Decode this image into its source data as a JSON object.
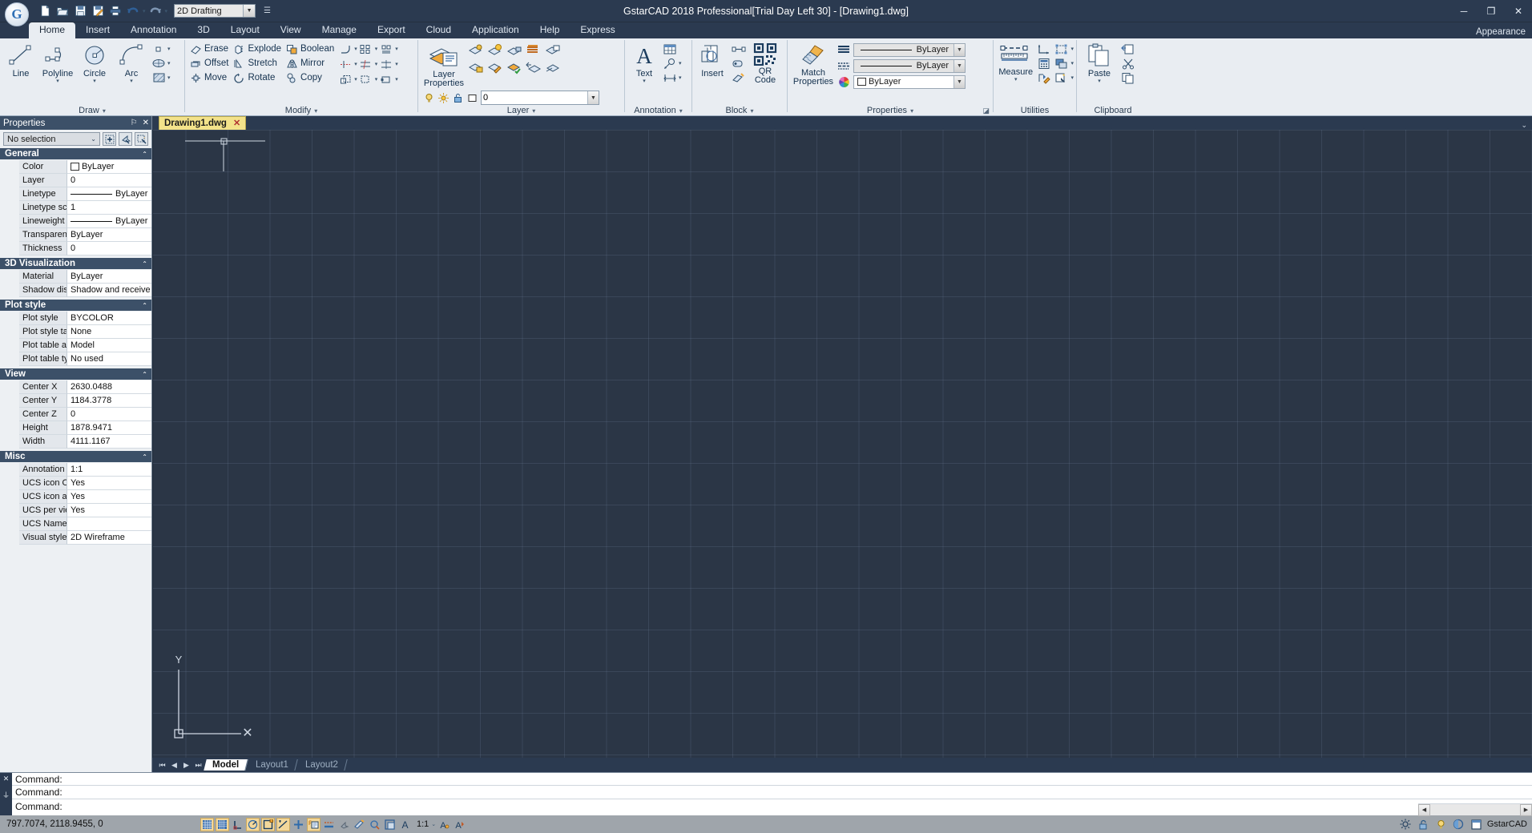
{
  "titlebar": {
    "title": "GstarCAD 2018 Professional[Trial Day Left 30] - [Drawing1.dwg]",
    "logo_letter": "G",
    "workspace_value": "2D Drafting",
    "quick_access": [
      {
        "name": "new-file-icon",
        "label": "New"
      },
      {
        "name": "open-file-icon",
        "label": "Open"
      },
      {
        "name": "save-icon",
        "label": "Save"
      },
      {
        "name": "save-as-icon",
        "label": "Save As"
      },
      {
        "name": "print-icon",
        "label": "Plot"
      },
      {
        "name": "undo-icon",
        "label": "Undo"
      },
      {
        "name": "redo-icon",
        "label": "Redo"
      }
    ],
    "window_buttons": {
      "minimize": "─",
      "maximize": "❐",
      "close": "✕"
    }
  },
  "ribbon_tabs": {
    "items": [
      {
        "label": "Home",
        "active": true
      },
      {
        "label": "Insert",
        "active": false
      },
      {
        "label": "Annotation",
        "active": false
      },
      {
        "label": "3D",
        "active": false
      },
      {
        "label": "Layout",
        "active": false
      },
      {
        "label": "View",
        "active": false
      },
      {
        "label": "Manage",
        "active": false
      },
      {
        "label": "Export",
        "active": false
      },
      {
        "label": "Cloud",
        "active": false
      },
      {
        "label": "Application",
        "active": false
      },
      {
        "label": "Help",
        "active": false
      },
      {
        "label": "Express",
        "active": false
      }
    ],
    "appearance": "Appearance"
  },
  "ribbon": {
    "draw": {
      "title": "Draw",
      "big_buttons": [
        {
          "label": "Line",
          "icon": "line-icon",
          "dropdown": false
        },
        {
          "label": "Polyline",
          "icon": "polyline-icon",
          "dropdown": true
        },
        {
          "label": "Circle",
          "icon": "circle-icon",
          "dropdown": true
        },
        {
          "label": "Arc",
          "icon": "arc-icon",
          "dropdown": true
        }
      ],
      "small_icons": [
        {
          "name": "rectangle-icon",
          "dropdown": true
        },
        {
          "name": "ellipse-icon",
          "dropdown": true
        },
        {
          "name": "hatch-icon",
          "dropdown": true
        }
      ]
    },
    "modify": {
      "title": "Modify",
      "commands": [
        {
          "label": "Erase",
          "icon": "erase-icon"
        },
        {
          "label": "Explode",
          "icon": "explode-icon"
        },
        {
          "label": "Boolean",
          "icon": "boolean-icon"
        },
        {
          "label": "Offset",
          "icon": "offset-icon"
        },
        {
          "label": "Stretch",
          "icon": "stretch-icon"
        },
        {
          "label": "Mirror",
          "icon": "mirror-icon"
        },
        {
          "label": "Move",
          "icon": "move-icon"
        },
        {
          "label": "Rotate",
          "icon": "rotate-icon"
        },
        {
          "label": "Copy",
          "icon": "copy-icon"
        }
      ],
      "extra_icons": [
        {
          "name": "fillet-icon",
          "dropdown": true
        },
        {
          "name": "array-icon",
          "dropdown": true
        },
        {
          "name": "trim-icon",
          "dropdown": true
        },
        {
          "name": "scale-icon",
          "dropdown": true
        },
        {
          "name": "break-icon",
          "dropdown": true
        },
        {
          "name": "align-icon",
          "dropdown": true
        },
        {
          "name": "edit-polyline-icon",
          "dropdown": true
        },
        {
          "name": "divide-icon",
          "dropdown": true
        },
        {
          "name": "stretch-multi-icon",
          "dropdown": true
        }
      ]
    },
    "layer": {
      "title": "Layer",
      "main_button": {
        "label": "Layer\nProperties",
        "line1": "Layer",
        "line2": "Properties",
        "icon": "layer-properties-icon"
      },
      "tool_icons": [
        {
          "name": "layer-isolate-icon"
        },
        {
          "name": "layer-on-icon"
        },
        {
          "name": "layer-unlock-icon"
        },
        {
          "name": "layer-freeze-icon"
        },
        {
          "name": "layer-off-icon"
        },
        {
          "name": "layer-previous-icon"
        },
        {
          "name": "layer-match-icon"
        },
        {
          "name": "layer-merge-icon"
        },
        {
          "name": "layer-lock-icon"
        },
        {
          "name": "layer-change-icon"
        },
        {
          "name": "layer-current-icon"
        },
        {
          "name": "layer-walk-icon"
        },
        {
          "name": "layer-delete-icon"
        }
      ],
      "layer_combo": {
        "value": "0",
        "status_icons": [
          "bulb-icon",
          "sun-icon",
          "lock-icon",
          "color-swatch-icon"
        ]
      }
    },
    "annotation": {
      "title": "Annotation",
      "main_button": {
        "label": "Text",
        "icon": "text-icon",
        "dropdown": true
      },
      "tool_icons": [
        {
          "name": "table-icon",
          "dropdown": false
        },
        {
          "name": "leader-icon",
          "dropdown": true
        },
        {
          "name": "dimension-icon",
          "dropdown": true
        }
      ]
    },
    "block": {
      "title": "Block",
      "main_button": {
        "label": "Insert",
        "icon": "insert-block-icon"
      },
      "tools": [
        {
          "name": "create-block-icon"
        },
        {
          "name": "edit-block-icon"
        },
        {
          "name": "define-attribute-icon"
        }
      ],
      "qr": {
        "label_line1": "QR",
        "label_line2": "Code",
        "icon": "qr-code-icon",
        "dropdown": true
      }
    },
    "properties": {
      "title": "Properties",
      "match_button": {
        "line1": "Match",
        "line2": "Properties",
        "icon": "match-properties-icon"
      },
      "rows": [
        {
          "icon": "lineweight-icon",
          "value": "ByLayer",
          "type": "lineweight"
        },
        {
          "icon": "linetype-icon",
          "value": "ByLayer",
          "type": "linetype"
        },
        {
          "icon": "color-wheel-icon",
          "value": "ByLayer",
          "type": "color"
        }
      ],
      "dialog_launcher": "properties-dialog-launcher"
    },
    "utilities": {
      "title": "Utilities",
      "main_button": {
        "label": "Measure",
        "icon": "measure-icon",
        "dropdown": true
      },
      "tools": [
        {
          "name": "ucs-icon"
        },
        {
          "name": "quick-select-icon",
          "dropdown": true
        },
        {
          "name": "calculator-icon"
        },
        {
          "name": "draworder-icon",
          "dropdown": true
        },
        {
          "name": "point-style-icon"
        },
        {
          "name": "isolate-objects-icon",
          "dropdown": true
        }
      ]
    },
    "clipboard": {
      "title": "Clipboard",
      "main_button": {
        "label": "Paste",
        "icon": "paste-icon",
        "dropdown": true
      },
      "tools": [
        {
          "name": "copy-clip-icon"
        },
        {
          "name": "cut-icon"
        },
        {
          "name": "copy-icon"
        }
      ]
    }
  },
  "properties_palette": {
    "header": "Properties",
    "header_buttons": [
      {
        "name": "auto-hide-icon",
        "glyph": "⚐"
      },
      {
        "name": "close-icon",
        "glyph": "✕"
      }
    ],
    "selection": "No selection",
    "toolbar_buttons": [
      {
        "name": "toggle-pickadd-icon",
        "glyph": "⬚"
      },
      {
        "name": "select-objects-icon",
        "glyph": "↖"
      },
      {
        "name": "quick-select-icon",
        "glyph": "⚒"
      }
    ],
    "groups": [
      {
        "title": "General",
        "rows": [
          {
            "key": "Color",
            "value": "ByLayer",
            "kind": "color"
          },
          {
            "key": "Layer",
            "value": "0",
            "kind": "text"
          },
          {
            "key": "Linetype",
            "value": "ByLayer",
            "kind": "linetype"
          },
          {
            "key": "Linetype scale",
            "value": "1",
            "kind": "text"
          },
          {
            "key": "Lineweight",
            "value": "ByLayer",
            "kind": "linetype"
          },
          {
            "key": "Transparency",
            "value": "ByLayer",
            "kind": "text"
          },
          {
            "key": "Thickness",
            "value": "0",
            "kind": "text"
          }
        ]
      },
      {
        "title": "3D Visualization",
        "rows": [
          {
            "key": "Material",
            "value": "ByLayer",
            "kind": "text"
          },
          {
            "key": "Shadow disp...",
            "value": "Shadow and receive ...",
            "kind": "text"
          }
        ]
      },
      {
        "title": "Plot style",
        "rows": [
          {
            "key": "Plot style",
            "value": "BYCOLOR",
            "kind": "text"
          },
          {
            "key": "Plot style table",
            "value": "None",
            "kind": "text"
          },
          {
            "key": "Plot table att...",
            "value": "Model",
            "kind": "text"
          },
          {
            "key": "Plot table type",
            "value": "No used",
            "kind": "text"
          }
        ]
      },
      {
        "title": "View",
        "rows": [
          {
            "key": "Center X",
            "value": "2630.0488",
            "kind": "text"
          },
          {
            "key": "Center Y",
            "value": "1184.3778",
            "kind": "text"
          },
          {
            "key": "Center Z",
            "value": "0",
            "kind": "text"
          },
          {
            "key": "Height",
            "value": "1878.9471",
            "kind": "text"
          },
          {
            "key": "Width",
            "value": "4111.1167",
            "kind": "text"
          }
        ]
      },
      {
        "title": "Misc",
        "rows": [
          {
            "key": "Annotation s...",
            "value": "1:1",
            "kind": "text"
          },
          {
            "key": "UCS icon On",
            "value": "Yes",
            "kind": "text"
          },
          {
            "key": "UCS icon at ...",
            "value": "Yes",
            "kind": "text"
          },
          {
            "key": "UCS per vie...",
            "value": "Yes",
            "kind": "text"
          },
          {
            "key": "UCS Name",
            "value": "",
            "kind": "text"
          },
          {
            "key": "Visual styles",
            "value": "2D Wireframe",
            "kind": "text"
          }
        ]
      }
    ]
  },
  "document": {
    "tab_label": "Drawing1.dwg",
    "tab_close": "✕",
    "overflow_glyph": "⌄"
  },
  "canvas": {
    "ucs_x_label": "X",
    "ucs_y_label": "Y",
    "background": "#2b3646"
  },
  "layout_bar": {
    "nav": [
      {
        "name": "first-layout-button",
        "glyph": "⏮"
      },
      {
        "name": "prev-layout-button",
        "glyph": "◀"
      },
      {
        "name": "next-layout-button",
        "glyph": "▶"
      },
      {
        "name": "last-layout-button",
        "glyph": "⏭"
      }
    ],
    "tabs": [
      {
        "label": "Model",
        "active": true
      },
      {
        "label": "Layout1",
        "active": false
      },
      {
        "label": "Layout2",
        "active": false
      }
    ]
  },
  "command_line": {
    "gutter": [
      {
        "name": "close-command-icon",
        "glyph": "✕"
      },
      {
        "name": "pin-command-icon",
        "glyph": "⏚"
      }
    ],
    "lines": [
      "Command:",
      "Command:",
      "Command:"
    ],
    "scroll_left": "◀",
    "scroll_right": "▶"
  },
  "statusbar": {
    "coordinates": "797.7074, 2118.9455, 0",
    "toggles": [
      {
        "name": "snap-mode-toggle",
        "label": "SNAP",
        "on": true
      },
      {
        "name": "grid-display-toggle",
        "label": "GRID",
        "on": true
      },
      {
        "name": "ortho-mode-toggle",
        "label": "ORTHO",
        "on": false
      },
      {
        "name": "polar-tracking-toggle",
        "label": "POLAR",
        "on": true
      },
      {
        "name": "object-snap-toggle",
        "label": "OSNAP",
        "on": true
      },
      {
        "name": "object-snap-tracking-toggle",
        "label": "OTRACK",
        "on": true
      },
      {
        "name": "dynamic-ucs-toggle",
        "label": "DUCS",
        "on": false
      },
      {
        "name": "dynamic-input-toggle",
        "label": "DYN",
        "on": true
      },
      {
        "name": "lineweight-toggle",
        "label": "LWT",
        "on": false
      },
      {
        "name": "transparency-toggle",
        "label": "TPY",
        "on": false
      },
      {
        "name": "quick-properties-toggle",
        "label": "QP",
        "on": false
      },
      {
        "name": "selection-cycling-toggle",
        "label": "SC",
        "on": false
      },
      {
        "name": "workspace-switch-toggle",
        "label": "WS",
        "on": false
      }
    ],
    "annotation_scale": "1:1",
    "annotation_scale_arrow": "⌄",
    "annotation_icons": [
      {
        "name": "annotation-visibility-icon"
      },
      {
        "name": "annotation-autoscale-icon"
      }
    ],
    "right_icons": [
      {
        "name": "gear-icon",
        "glyph": "⚙"
      },
      {
        "name": "unlock-icon",
        "glyph": "🔓"
      },
      {
        "name": "bulb-icon",
        "glyph": "💡"
      },
      {
        "name": "clean-screen-icon",
        "glyph": "◴"
      },
      {
        "name": "maximize-viewport-icon",
        "glyph": "❑"
      }
    ],
    "brand": "GstarCAD"
  }
}
